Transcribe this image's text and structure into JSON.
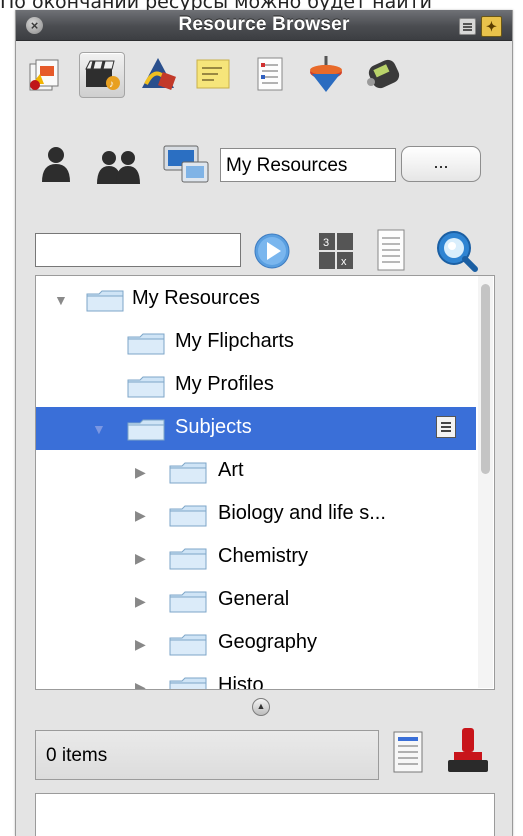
{
  "caption": "По окончании ресурсы можно будет найти",
  "window": {
    "title": "Resource Browser"
  },
  "toolbar_icons": [
    "resources-pack-icon",
    "media-clapper-icon",
    "drawing-tools-icon",
    "sticky-notes-icon",
    "checklist-icon",
    "spinning-top-icon",
    "remote-device-icon"
  ],
  "profile_row": {
    "location_value": "My Resources",
    "more_label": "..."
  },
  "search": {
    "value": ""
  },
  "tree": {
    "root": "My Resources",
    "items": [
      {
        "label": "My Resources"
      },
      {
        "label": "My Flipcharts"
      },
      {
        "label": "My Profiles"
      },
      {
        "label": "Subjects"
      },
      {
        "label": "Art"
      },
      {
        "label": "Biology and life s..."
      },
      {
        "label": "Chemistry"
      },
      {
        "label": "General"
      },
      {
        "label": "Geography"
      },
      {
        "label": "Histo"
      }
    ]
  },
  "status": {
    "items_count": "0 items"
  },
  "colors": {
    "selection": "#3a6fd8",
    "titlebar": "#4a4c50",
    "accent_gold": "#e9c24b"
  }
}
